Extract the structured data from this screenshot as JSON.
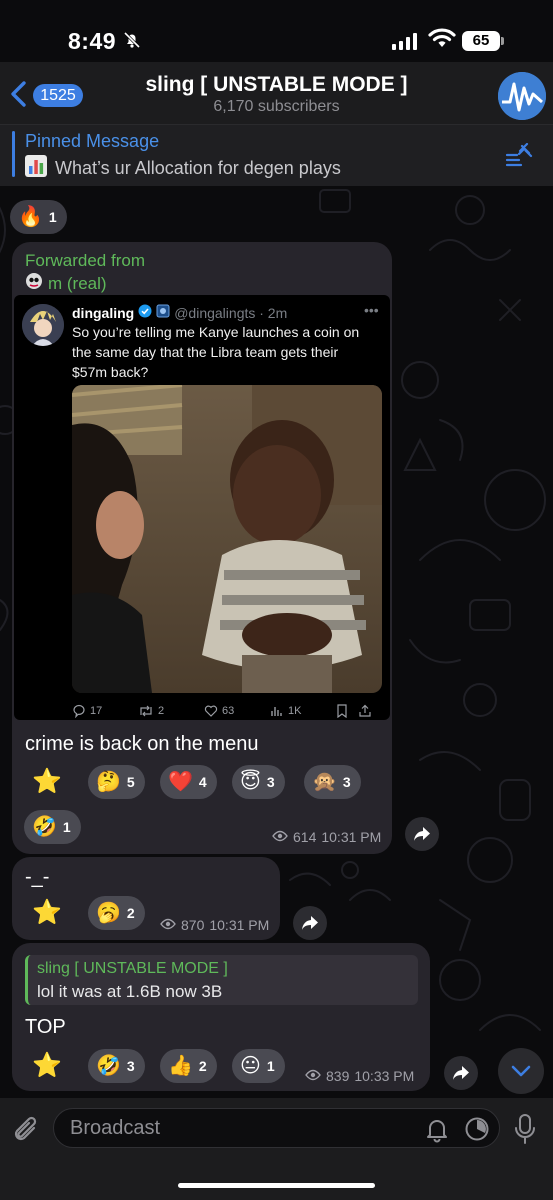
{
  "status": {
    "time": "8:49",
    "battery": "65"
  },
  "header": {
    "back_count": "1525",
    "title": "sling [ UNSTABLE MODE ]",
    "subscribers": "6,170 subscribers"
  },
  "pinned": {
    "label": "Pinned Message",
    "text": "What’s ur Allocation for degen plays"
  },
  "top_reaction": {
    "emoji": "🔥",
    "count": "1"
  },
  "post1": {
    "forwarded_label": "Forwarded from",
    "forwarded_name": "m (real)",
    "tweet": {
      "name": "dingaling",
      "handle": "@dingalingts · 2m",
      "text": "So you’re telling me Kanye launches a coin on the same day that the Libra team gets their $57m back?",
      "replies": "17",
      "retweets": "2",
      "likes": "63",
      "views": "1K"
    },
    "text": "crime is back on the menu",
    "reactions": [
      {
        "emoji": "⭐",
        "count": ""
      },
      {
        "emoji": "🤔",
        "count": "5"
      },
      {
        "emoji": "❤️",
        "count": "4"
      },
      {
        "emoji": "😇",
        "count": "3"
      },
      {
        "emoji": "🙊",
        "count": "3"
      },
      {
        "emoji": "🤣",
        "count": "1"
      }
    ],
    "views": "614",
    "time": "10:31 PM"
  },
  "post2": {
    "text": "-_-",
    "reactions": [
      {
        "emoji": "⭐",
        "count": ""
      },
      {
        "emoji": "🥱",
        "count": "2"
      }
    ],
    "views": "870",
    "time": "10:31 PM"
  },
  "post3": {
    "reply_name": "sling [ UNSTABLE MODE ]",
    "reply_text": "lol it was at 1.6B now 3B",
    "text": "TOP",
    "reactions": [
      {
        "emoji": "⭐",
        "count": ""
      },
      {
        "emoji": "🤣",
        "count": "3"
      },
      {
        "emoji": "👍",
        "count": "2"
      },
      {
        "emoji": "😐",
        "count": "1"
      }
    ],
    "views": "839",
    "time": "10:33 PM"
  },
  "input": {
    "placeholder": "Broadcast"
  }
}
